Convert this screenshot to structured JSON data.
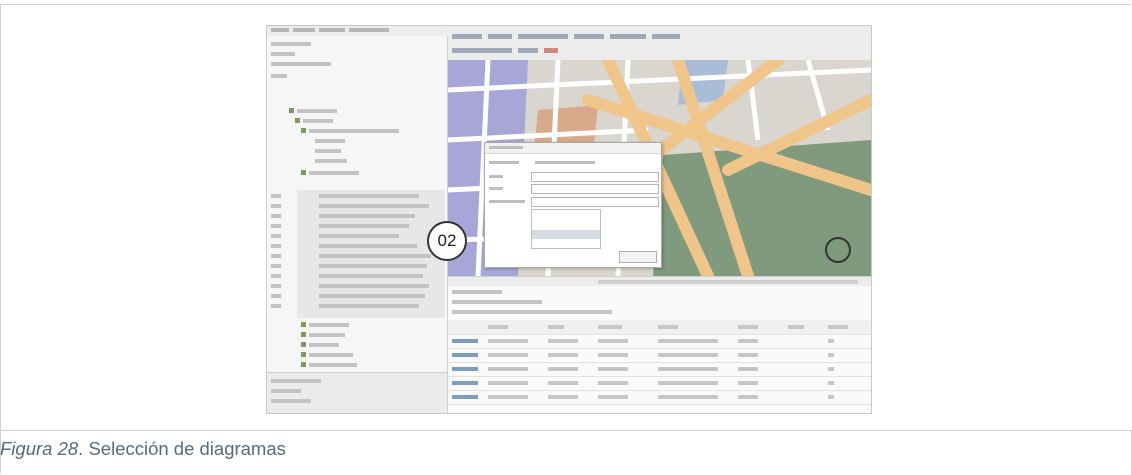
{
  "figure": {
    "callout_label": "02",
    "caption_label": "Figura 28",
    "caption_separator": ".  ",
    "caption_text": "Selección de diagramas"
  },
  "colors": {
    "map_background": "#dcd8d2",
    "park_green": "#7f9a7c",
    "main_road": "#f0c58a",
    "district_purple": "#a8a6d6",
    "caption_text": "#5a6a7a"
  }
}
